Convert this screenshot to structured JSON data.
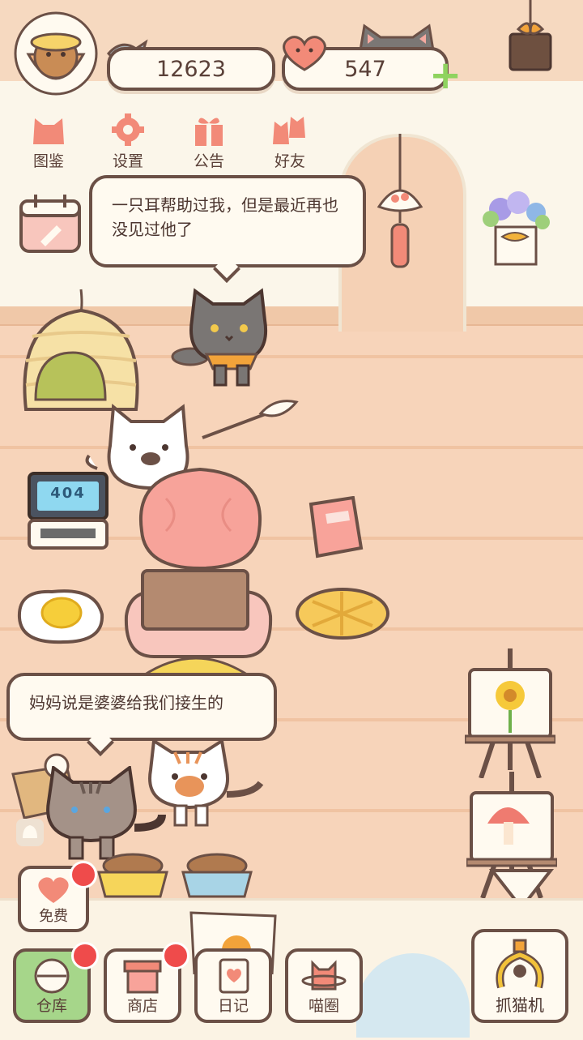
{
  "currency": {
    "fish_count": "12623",
    "hearts_count": "547",
    "plus_symbol": "+"
  },
  "top_menu": [
    {
      "label": "图鉴",
      "icon": "cat-face-icon"
    },
    {
      "label": "设置",
      "icon": "gear-icon"
    },
    {
      "label": "公告",
      "icon": "gift-icon"
    },
    {
      "label": "好友",
      "icon": "friends-icon"
    }
  ],
  "bubbles": {
    "top": "一只耳帮助过我，但是最近再也没见过他了",
    "bottom": "妈妈说是婆婆给我们接生的"
  },
  "laptop_screen": "404",
  "free_button": {
    "label": "免费"
  },
  "bottom_nav": [
    {
      "label": "仓库",
      "active": true,
      "badge": true
    },
    {
      "label": "商店",
      "active": false,
      "badge": true
    },
    {
      "label": "日记",
      "active": false,
      "badge": false
    },
    {
      "label": "喵圈",
      "active": false,
      "badge": false
    }
  ],
  "claw_machine": {
    "label": "抓猫机"
  },
  "colors": {
    "outline": "#6b5046",
    "accent_salmon": "#f28a78",
    "badge_red": "#ef4b4b",
    "active_green": "#a6d68a",
    "plus_green": "#8fd35f"
  }
}
